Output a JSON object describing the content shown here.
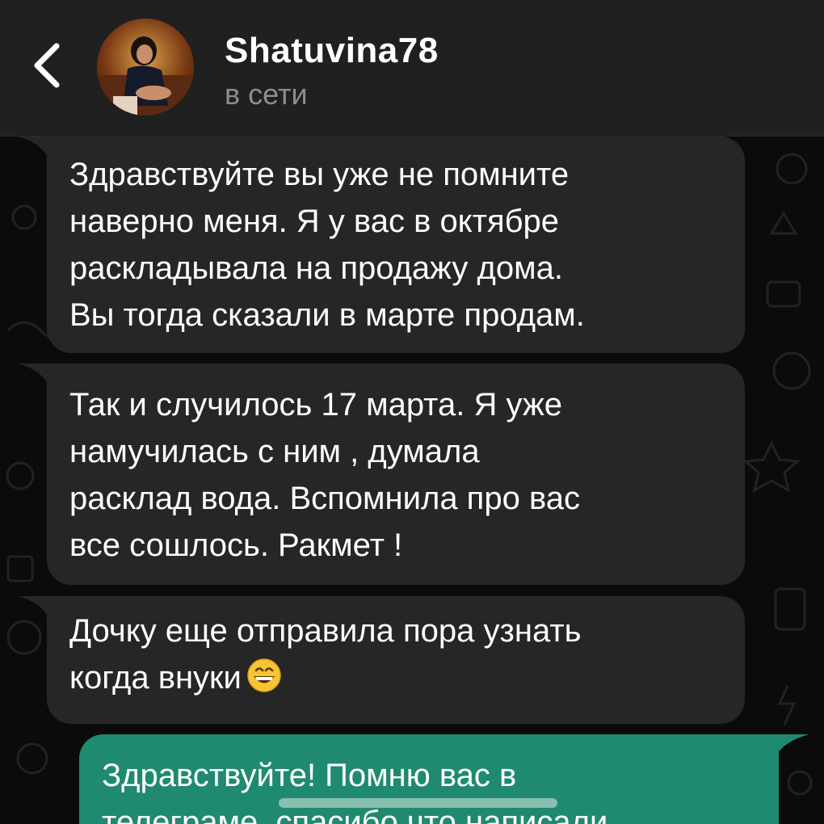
{
  "header": {
    "back_icon": "chevron-left-icon",
    "contact_name": "Shatuvina78",
    "status": "в сети"
  },
  "messages": [
    {
      "direction": "incoming",
      "text": "Здравствуйте вы уже не помните\nнаверно меня. Я у вас в октябре\nраскладывала на продажу дома.\nВы тогда сказали в марте продам."
    },
    {
      "direction": "incoming",
      "text": "Так и случилось 17 марта. Я уже\nнамучилась с ним , думала\nрасклад вода. Вспомнила про вас\nвсе сошлось. Ракмет !"
    },
    {
      "direction": "incoming",
      "text": "Дочку еще отправила пора узнать\nкогда внуки",
      "emoji": "grinning-face-icon"
    },
    {
      "direction": "outgoing",
      "text": "Здравствуйте! Помню вас в\nтелеграме, спасибо что написали"
    }
  ],
  "colors": {
    "header_bg": "#202020",
    "chat_bg": "#0b0b0b",
    "incoming_bubble": "#262626",
    "outgoing_bubble": "#1f8a70",
    "status_text": "#8d8d8d"
  }
}
